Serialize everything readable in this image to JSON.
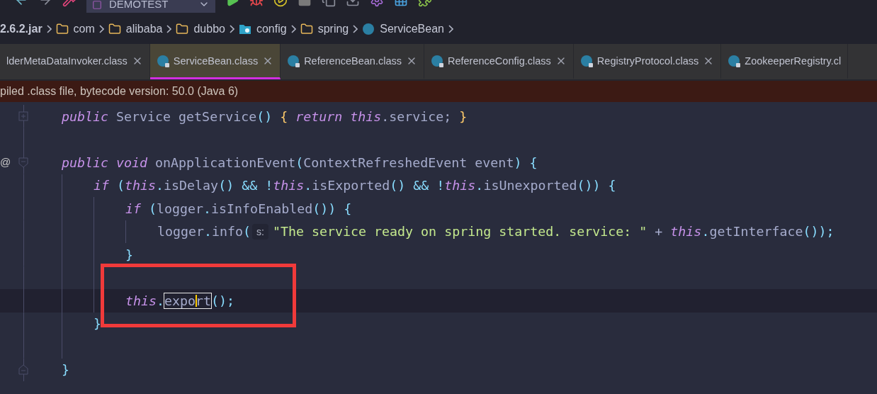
{
  "toolbar": {
    "run_configuration": "DEMOTEST"
  },
  "breadcrumb": [
    {
      "kind": "jar",
      "label": "2.6.2.jar"
    },
    {
      "kind": "package",
      "label": "com"
    },
    {
      "kind": "package",
      "label": "alibaba"
    },
    {
      "kind": "package",
      "label": "dubbo"
    },
    {
      "kind": "config",
      "label": "config"
    },
    {
      "kind": "package",
      "label": "spring"
    },
    {
      "kind": "class",
      "label": "ServiceBean"
    }
  ],
  "tabs": [
    {
      "label": "lderMetaDataInvoker.class",
      "selected": false,
      "icon": false,
      "closable": true
    },
    {
      "label": "ServiceBean.class",
      "selected": true,
      "icon": true,
      "closable": true
    },
    {
      "label": "ReferenceBean.class",
      "selected": false,
      "icon": true,
      "closable": true
    },
    {
      "label": "ReferenceConfig.class",
      "selected": false,
      "icon": true,
      "closable": true
    },
    {
      "label": "RegistryProtocol.class",
      "selected": false,
      "icon": true,
      "closable": true
    },
    {
      "label": "ZookeeperRegistry.cl",
      "selected": false,
      "icon": true,
      "closable": false
    }
  ],
  "banner": "piled .class file, bytecode version: 50.0 (Java 6)",
  "code": [
    {
      "kind": "code",
      "fold_start": true,
      "collapsed": true,
      "tokens": [
        {
          "kind": "kw",
          "text": "public"
        },
        {
          "kind": "id",
          "text": " Service getService"
        },
        {
          "kind": "punct",
          "text": "()"
        },
        {
          "kind": "brace",
          "text": " {"
        },
        {
          "kind": "kw",
          "text": " return this"
        },
        {
          "kind": "id",
          "text": ".service;"
        },
        {
          "kind": "brace",
          "text": " }"
        }
      ]
    },
    {
      "kind": "blank"
    },
    {
      "kind": "code",
      "fold_start": true,
      "collapsed": false,
      "marker": "@",
      "tokens": [
        {
          "kind": "kw",
          "text": "public void"
        },
        {
          "kind": "id",
          "text": " onApplicationEvent"
        },
        {
          "kind": "punct",
          "text": "("
        },
        {
          "kind": "id",
          "text": "ContextRefreshedEvent event"
        },
        {
          "kind": "punct",
          "text": ")"
        },
        {
          "kind": "punct",
          "text": " {"
        }
      ],
      "children": [
        {
          "kind": "code",
          "tokens": [
            {
              "kind": "kw",
              "text": "if"
            },
            {
              "kind": "punct",
              "text": " ("
            },
            {
              "kind": "kw",
              "text": "this"
            },
            {
              "kind": "punct",
              "text": "."
            },
            {
              "kind": "id",
              "text": "isDelay"
            },
            {
              "kind": "punct",
              "text": "() && !"
            },
            {
              "kind": "kw",
              "text": "this"
            },
            {
              "kind": "punct",
              "text": "."
            },
            {
              "kind": "id",
              "text": "isExported"
            },
            {
              "kind": "punct",
              "text": "() && !"
            },
            {
              "kind": "kw",
              "text": "this"
            },
            {
              "kind": "punct",
              "text": "."
            },
            {
              "kind": "id",
              "text": "isUnexported"
            },
            {
              "kind": "punct",
              "text": "()) {"
            }
          ],
          "children": [
            {
              "kind": "code",
              "tokens": [
                {
                  "kind": "kw",
                  "text": "if"
                },
                {
                  "kind": "punct",
                  "text": " ("
                },
                {
                  "kind": "id",
                  "text": "logger"
                },
                {
                  "kind": "punct",
                  "text": "."
                },
                {
                  "kind": "id",
                  "text": "isInfoEnabled"
                },
                {
                  "kind": "punct",
                  "text": "()) {"
                }
              ],
              "children": [
                {
                  "kind": "code",
                  "tokens": [
                    {
                      "kind": "id",
                      "text": "logger"
                    },
                    {
                      "kind": "punct",
                      "text": "."
                    },
                    {
                      "kind": "id",
                      "text": "info"
                    },
                    {
                      "kind": "punct",
                      "text": "("
                    },
                    {
                      "kind": "hint",
                      "text": "s:"
                    },
                    {
                      "kind": "str",
                      "text": "\"The service ready on spring started. service: \""
                    },
                    {
                      "kind": "id",
                      "text": " + "
                    },
                    {
                      "kind": "kw",
                      "text": "this"
                    },
                    {
                      "kind": "punct",
                      "text": "."
                    },
                    {
                      "kind": "id",
                      "text": "getInterface"
                    },
                    {
                      "kind": "punct",
                      "text": "());"
                    }
                  ]
                }
              ]
            },
            {
              "kind": "code",
              "tokens": [
                {
                  "kind": "punct",
                  "text": "}"
                }
              ]
            },
            {
              "kind": "blank"
            },
            {
              "kind": "code",
              "current": true,
              "tokens": [
                {
                  "kind": "kw",
                  "text": "this"
                },
                {
                  "kind": "punct",
                  "text": "."
                },
                {
                  "kind": "id",
                  "text": "export",
                  "boxed": true,
                  "caret": true
                },
                {
                  "kind": "punct",
                  "text": "();"
                }
              ]
            }
          ]
        },
        {
          "kind": "code",
          "tokens": [
            {
              "kind": "punct",
              "text": "}"
            }
          ]
        },
        {
          "kind": "blank"
        }
      ]
    },
    {
      "kind": "code",
      "fold_end": true,
      "tokens": [
        {
          "kind": "punct",
          "text": "}"
        }
      ]
    }
  ],
  "annotation": {
    "kind": "rectangle",
    "color": "#f03a3a"
  }
}
